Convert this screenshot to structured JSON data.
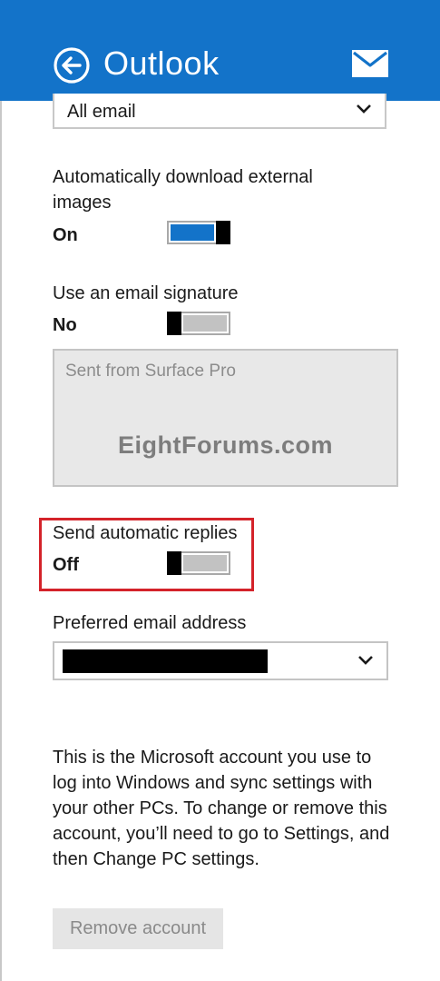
{
  "header": {
    "title": "Outlook",
    "accent": "#1373c9"
  },
  "icons": {
    "back": "back-arrow-circle-icon",
    "mail": "envelope-icon",
    "dropdown": "chevron-down-icon"
  },
  "download_filter": {
    "value": "All email"
  },
  "external_images": {
    "label": "Automatically download external images",
    "state": "On",
    "on": true
  },
  "signature": {
    "label": "Use an email signature",
    "state": "No",
    "on": false,
    "text": "Sent from Surface Pro"
  },
  "watermark": "EightForums.com",
  "auto_replies": {
    "label": "Send automatic replies",
    "state": "Off",
    "on": false,
    "highlight_color": "#d4232a"
  },
  "preferred_email": {
    "label": "Preferred email address",
    "value_redacted": true
  },
  "account_info": "This is the Microsoft account you use to log into Windows and sync settings with your other PCs. To change or remove this account, you’ll need to go to Settings, and then Change PC settings.",
  "remove_button": "Remove account"
}
